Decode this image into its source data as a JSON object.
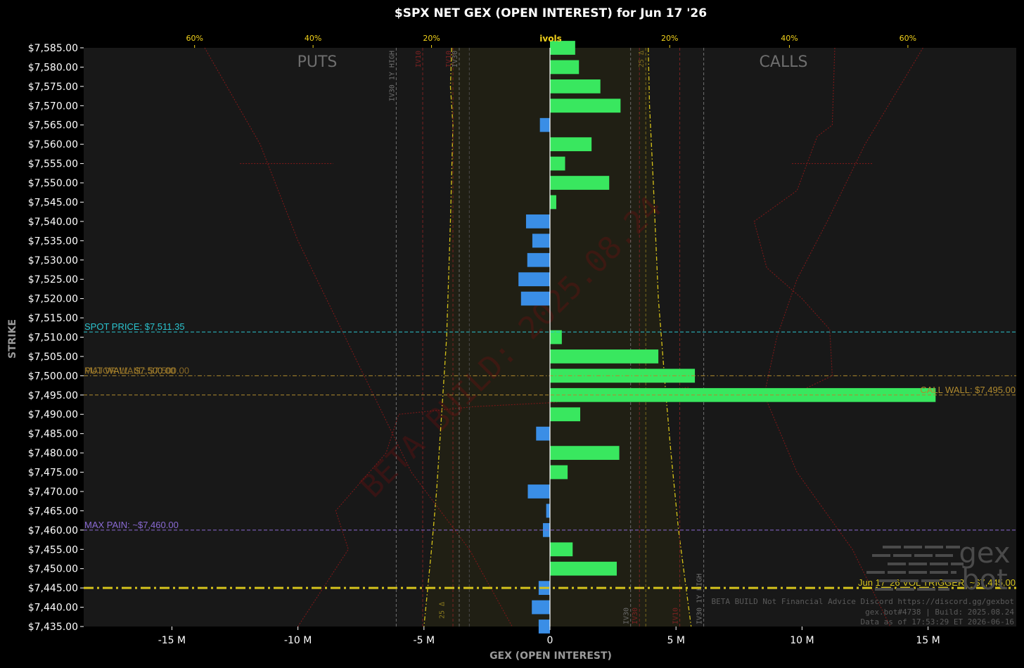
{
  "chart_data": {
    "type": "bar",
    "orientation": "horizontal",
    "title": "$SPX NET GEX (OPEN INTEREST) for Jun 17 '26",
    "xlabel": "GEX (OPEN INTEREST)",
    "ylabel": "STRIKE",
    "xlim": [
      -18.5,
      18.5
    ],
    "ylim": [
      7435,
      7585
    ],
    "x_units": "M",
    "x_ticks": [
      -15,
      -10,
      -5,
      0,
      5,
      10,
      15
    ],
    "x_tick_labels": [
      "-15 M",
      "-10 M",
      "-5 M",
      "0",
      "5 M",
      "10 M",
      "15 M"
    ],
    "y_tick_labels": [
      "$7,585.00",
      "$7,580.00",
      "$7,575.00",
      "$7,570.00",
      "$7,565.00",
      "$7,560.00",
      "$7,555.00",
      "$7,550.00",
      "$7,545.00",
      "$7,540.00",
      "$7,535.00",
      "$7,530.00",
      "$7,525.00",
      "$7,520.00",
      "$7,515.00",
      "$7,510.00",
      "$7,505.00",
      "$7,500.00",
      "$7,495.00",
      "$7,490.00",
      "$7,485.00",
      "$7,480.00",
      "$7,475.00",
      "$7,470.00",
      "$7,465.00",
      "$7,460.00",
      "$7,455.00",
      "$7,450.00",
      "$7,445.00",
      "$7,440.00",
      "$7,435.00"
    ],
    "strikes": [
      7585,
      7580,
      7575,
      7570,
      7565,
      7560,
      7555,
      7550,
      7545,
      7540,
      7535,
      7530,
      7525,
      7520,
      7515,
      7510,
      7505,
      7500,
      7495,
      7490,
      7485,
      7480,
      7475,
      7470,
      7465,
      7460,
      7455,
      7450,
      7445,
      7440,
      7435
    ],
    "values": [
      1.0,
      1.15,
      2.0,
      2.8,
      -0.4,
      1.65,
      0.6,
      2.35,
      0.25,
      -0.95,
      -0.7,
      -0.9,
      -1.25,
      -1.15,
      0,
      0.47,
      4.3,
      5.75,
      15.3,
      1.2,
      -0.55,
      2.75,
      0.7,
      -0.88,
      -0.15,
      -0.28,
      0.9,
      2.65,
      -0.45,
      -0.72,
      -0.45
    ],
    "colors": {
      "positive": "#39e75f",
      "negative": "#3a8ee6"
    },
    "side_labels": {
      "puts": "PUTS",
      "calls": "CALLS"
    },
    "ivol_axis": {
      "label": "ivols",
      "ticks": [
        {
          "text": "60%",
          "x": -14.1
        },
        {
          "text": "40%",
          "x": -9.4
        },
        {
          "text": "20%",
          "x": -4.7
        },
        {
          "text": "20%",
          "x": 4.75
        },
        {
          "text": "40%",
          "x": 9.5
        },
        {
          "text": "60%",
          "x": 14.2
        }
      ]
    },
    "levels": [
      {
        "label": "SPOT PRICE: $7,511.35",
        "y": 7511.35,
        "color": "#2bc4cf",
        "style": "dashed",
        "align": "left"
      },
      {
        "label": "PUT WALL: $7,500.00",
        "y": 7500,
        "color": "#b08a2e",
        "style": "dashdot",
        "align": "left"
      },
      {
        "label": "MAJOR WALL: $7,500.00",
        "y": 7500,
        "color": "#8a6a26",
        "style": "none",
        "align": "left"
      },
      {
        "label": "CALL WALL: $7,495.00",
        "y": 7495,
        "color": "#b08a2e",
        "style": "dashed",
        "align": "right"
      },
      {
        "label": "MAX PAIN: ~$7,460.00",
        "y": 7460,
        "color": "#8a6ad4",
        "style": "dashed",
        "align": "left"
      },
      {
        "label": "Jun 17 '26 VOL TRIGGER: ~$7,445.00",
        "y": 7445,
        "color": "#d4c21c",
        "style": "dashdot-thick",
        "align": "right"
      }
    ],
    "vlines": [
      {
        "x": -6.1,
        "label": "IV30 1Y HIGH",
        "color": "#707070",
        "label_pos": "top"
      },
      {
        "x": -5.05,
        "label": "IV10",
        "color": "#7a2222",
        "label_pos": "top"
      },
      {
        "x": -3.85,
        "label": "IV10",
        "color": "#7a2222",
        "label_pos": "top"
      },
      {
        "x": -3.6,
        "label": "IV30",
        "color": "#6a6a6a",
        "label_pos": "top"
      },
      {
        "x": -3.2,
        "label": "",
        "color": "#4a4a4a",
        "label_pos": "top"
      },
      {
        "x": 3.2,
        "label": "IV30",
        "color": "#6a6a6a",
        "label_pos": "bottom"
      },
      {
        "x": 3.55,
        "label": "IV30",
        "color": "#7a2222",
        "label_pos": "bottom"
      },
      {
        "x": 3.8,
        "label": "25 Δ",
        "color": "#7a6a1e",
        "label_pos": "top"
      },
      {
        "x": 5.15,
        "label": "IV10",
        "color": "#7a2222",
        "label_pos": "bottom"
      },
      {
        "x": 6.1,
        "label": "IV30 1Y HIGH",
        "color": "#707070",
        "label_pos": "bottom"
      }
    ],
    "put_25d_label": "25 Δ",
    "watermark": "BETA BUILD: 2025.08.24",
    "logo": "gex bot",
    "footer": [
      "BETA BUILD Not Financial Advice Discord https://discord.gg/gexbot",
      "gex.bot#4738 | Build: 2025.08.24",
      "Data as of 17:53:29 ET 2026-06-16"
    ]
  }
}
